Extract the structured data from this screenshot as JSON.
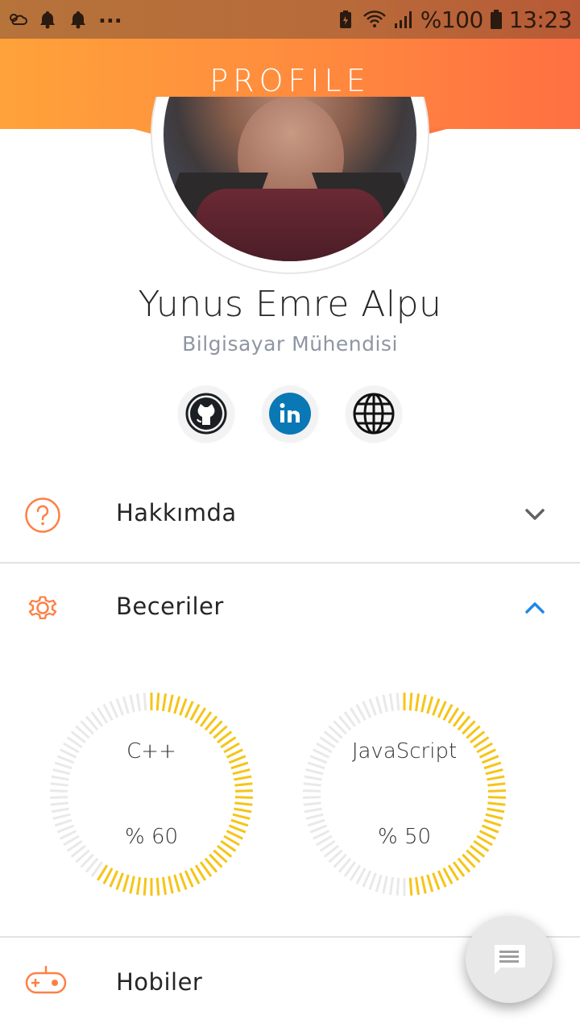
{
  "status_bar": {
    "battery_text": "%100",
    "time": "13:23",
    "overflow": "..."
  },
  "app_bar": {
    "title": "PROFILE"
  },
  "profile": {
    "name": "Yunus Emre Alpu",
    "title": "Bilgisayar Mühendisi"
  },
  "social": {
    "items": [
      {
        "icon": "github-icon"
      },
      {
        "icon": "linkedin-icon"
      },
      {
        "icon": "globe-icon"
      }
    ]
  },
  "sections": {
    "about": {
      "label": "Hakkımda",
      "expanded": false
    },
    "skills": {
      "label": "Beceriler",
      "expanded": true
    },
    "hobbies": {
      "label": "Hobiler",
      "expanded": false
    }
  },
  "skills": [
    {
      "name": "C++",
      "percent_label": "% 60",
      "percent": 60
    },
    {
      "name": "JavaScript",
      "percent_label": "% 50",
      "percent": 50
    }
  ],
  "colors": {
    "accent_orange": "#ff7f44",
    "progress_yellow": "#f5c518",
    "track_gray": "#e9e9e9",
    "chevron_gray": "#616161",
    "chevron_blue": "#1e88e5"
  },
  "fab": {
    "icon": "chat-icon"
  }
}
